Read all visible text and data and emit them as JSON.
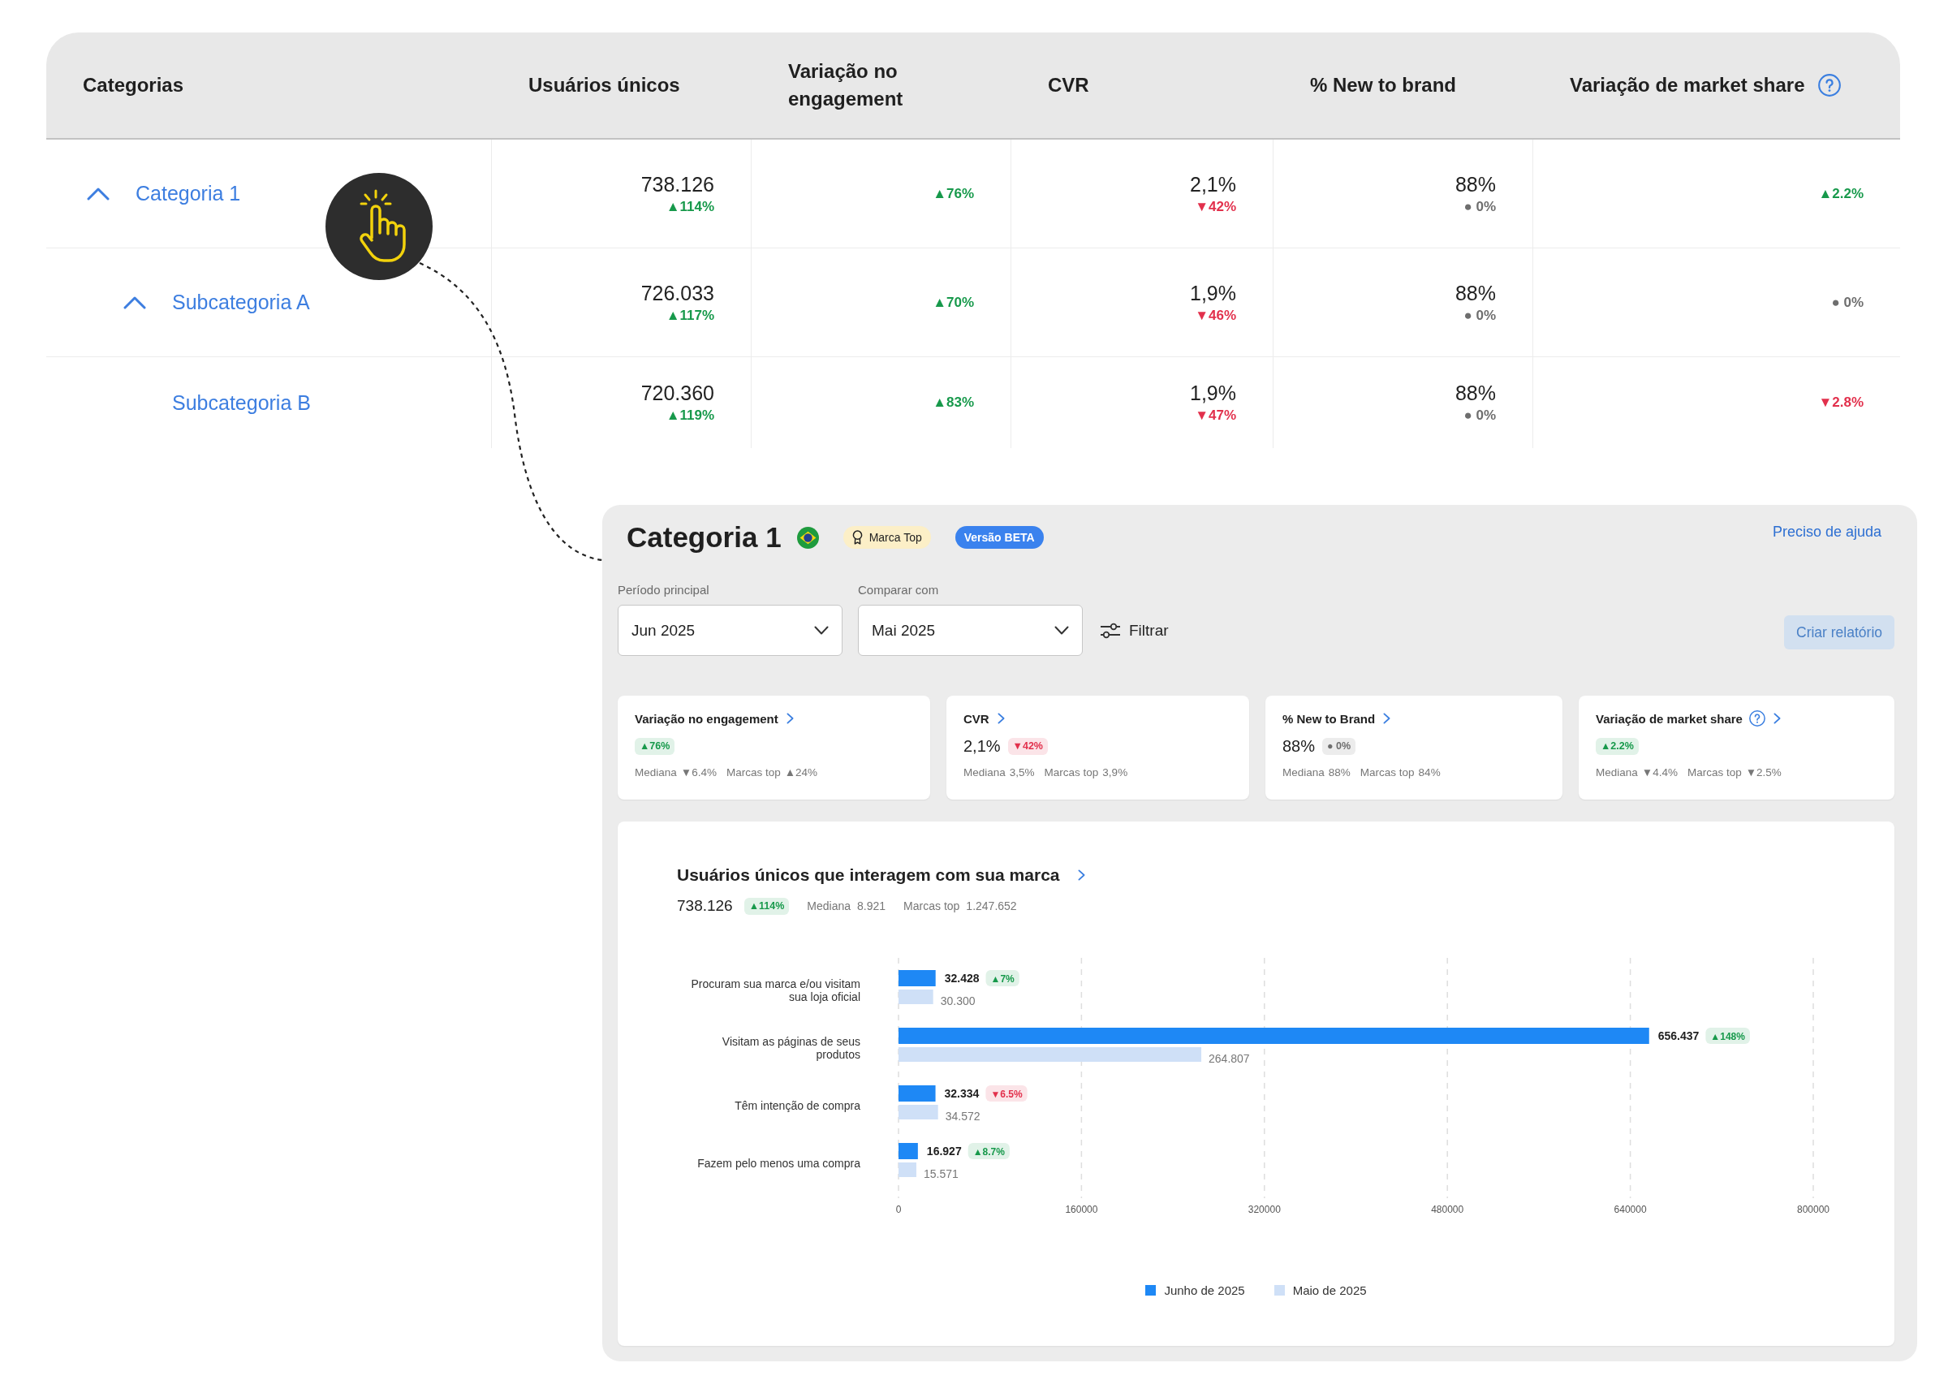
{
  "table": {
    "columns": [
      {
        "label": "Categorias",
        "help": false
      },
      {
        "label": "Usuários únicos",
        "help": false
      },
      {
        "label": "Variação no engagement",
        "help": false
      },
      {
        "label": "CVR",
        "help": false
      },
      {
        "label": "% New to brand",
        "help": false
      },
      {
        "label": "Variação de market share",
        "help": true
      }
    ],
    "rows": [
      {
        "name": "Categoria 1",
        "expanded": true,
        "cells": [
          {
            "value": "738.126",
            "delta": "▲114%",
            "color": "#17994b"
          },
          {
            "delta": "▲76%",
            "color": "#17994b"
          },
          {
            "value": "2,1%",
            "delta": "▼42%",
            "color": "#e2304c"
          },
          {
            "value": "88%",
            "delta": "● 0%",
            "color": "#6e6e6e"
          },
          {
            "delta": "▲2.2%",
            "color": "#17994b"
          }
        ],
        "children": [
          {
            "name": "Subcategoria A",
            "expanded": true,
            "cells": [
              {
                "value": "726.033",
                "delta": "▲117%",
                "color": "#17994b"
              },
              {
                "delta": "▲70%",
                "color": "#17994b"
              },
              {
                "value": "1,9%",
                "delta": "▼46%",
                "color": "#e2304c"
              },
              {
                "value": "88%",
                "delta": "● 0%",
                "color": "#6e6e6e"
              },
              {
                "delta": "● 0%",
                "color": "#6e6e6e"
              }
            ]
          },
          {
            "name": "Subcategoria B",
            "cells": [
              {
                "value": "720.360",
                "delta": "▲119%",
                "color": "#17994b"
              },
              {
                "delta": "▲83%",
                "color": "#17994b"
              },
              {
                "value": "1,9%",
                "delta": "▼47%",
                "color": "#e2304c"
              },
              {
                "value": "88%",
                "delta": "● 0%",
                "color": "#6e6e6e"
              },
              {
                "delta": "▼2.8%",
                "color": "#e2304c"
              }
            ]
          }
        ]
      }
    ]
  },
  "detail_panel": {
    "title": "Categoria 1",
    "badges": [
      {
        "kind": "award",
        "label": "Marca Top"
      },
      {
        "kind": "beta",
        "label": "Versão BETA"
      }
    ],
    "help_link": "Preciso de ajuda",
    "selects": [
      {
        "label": "Período principal",
        "value": "Jun 2025"
      },
      {
        "label": "Comparar com",
        "value": "Mai 2025"
      }
    ],
    "filter_button": "Filtrar",
    "report_button": "Criar relatório",
    "metric_cards": [
      {
        "title": "Variação no engagement",
        "help": false,
        "delta": "▲76%",
        "color": "#17994b",
        "stats": [
          {
            "label": "Mediana",
            "value": "▼6.4%"
          },
          {
            "label": "Marcas top",
            "value": "▲24%"
          }
        ]
      },
      {
        "title": "CVR",
        "help": false,
        "value": "2,1%",
        "delta": "▼42%",
        "color": "#e2304c",
        "stats": [
          {
            "label": "Mediana",
            "value": "3,5%"
          },
          {
            "label": "Marcas top",
            "value": "3,9%"
          }
        ]
      },
      {
        "title": "% New to Brand",
        "help": false,
        "value": "88%",
        "delta": "● 0%",
        "color": "#6e6e6e",
        "stats": [
          {
            "label": "Mediana",
            "value": "88%"
          },
          {
            "label": "Marcas top",
            "value": "84%"
          }
        ]
      },
      {
        "title": "Variação de market share",
        "help": true,
        "delta": "▲2.2%",
        "color": "#17994b",
        "stats": [
          {
            "label": "Mediana",
            "value": "▼4.4%"
          },
          {
            "label": "Marcas top",
            "value": "▼2.5%"
          }
        ]
      }
    ],
    "chart_card": {
      "title": "Usuários únicos que interagem com sua marca",
      "total": "738.126",
      "delta": "▲114%",
      "color": "#17994b",
      "stats": [
        {
          "label": "Mediana",
          "value": "8.921"
        },
        {
          "label": "Marcas top",
          "value": "1.247.652"
        }
      ],
      "bar_labels": [
        [
          "32.428",
          "656.437",
          "32.334",
          "16.927"
        ],
        [
          "30.300",
          "264.807",
          "34.572",
          "15.571"
        ]
      ],
      "bar_deltas": [
        {
          "text": "▲7%",
          "color": "#17994b"
        },
        {
          "text": "▲148%",
          "color": "#17994b"
        },
        {
          "text": "▼6.5%",
          "color": "#e2304c"
        },
        {
          "text": "▲8.7%",
          "color": "#17994b"
        }
      ],
      "chart_data": {
        "type": "bar",
        "orientation": "horizontal",
        "categories": [
          "Procuram sua marca e/ou visitam sua loja oficial",
          "Visitam as páginas de seus produtos",
          "Têm intenção de compra",
          "Fazem pelo menos uma compra"
        ],
        "series": [
          {
            "name": "Junho de 2025",
            "color": "#1e88f5",
            "values": [
              32428,
              656437,
              32334,
              16927
            ]
          },
          {
            "name": "Maio de 2025",
            "color": "#cfe0f7",
            "values": [
              30300,
              264807,
              34572,
              15571
            ]
          }
        ],
        "xlim": [
          0,
          800000
        ],
        "xticks": [
          0,
          160000,
          320000,
          480000,
          640000,
          800000
        ],
        "grid": true,
        "legend": true
      }
    }
  }
}
